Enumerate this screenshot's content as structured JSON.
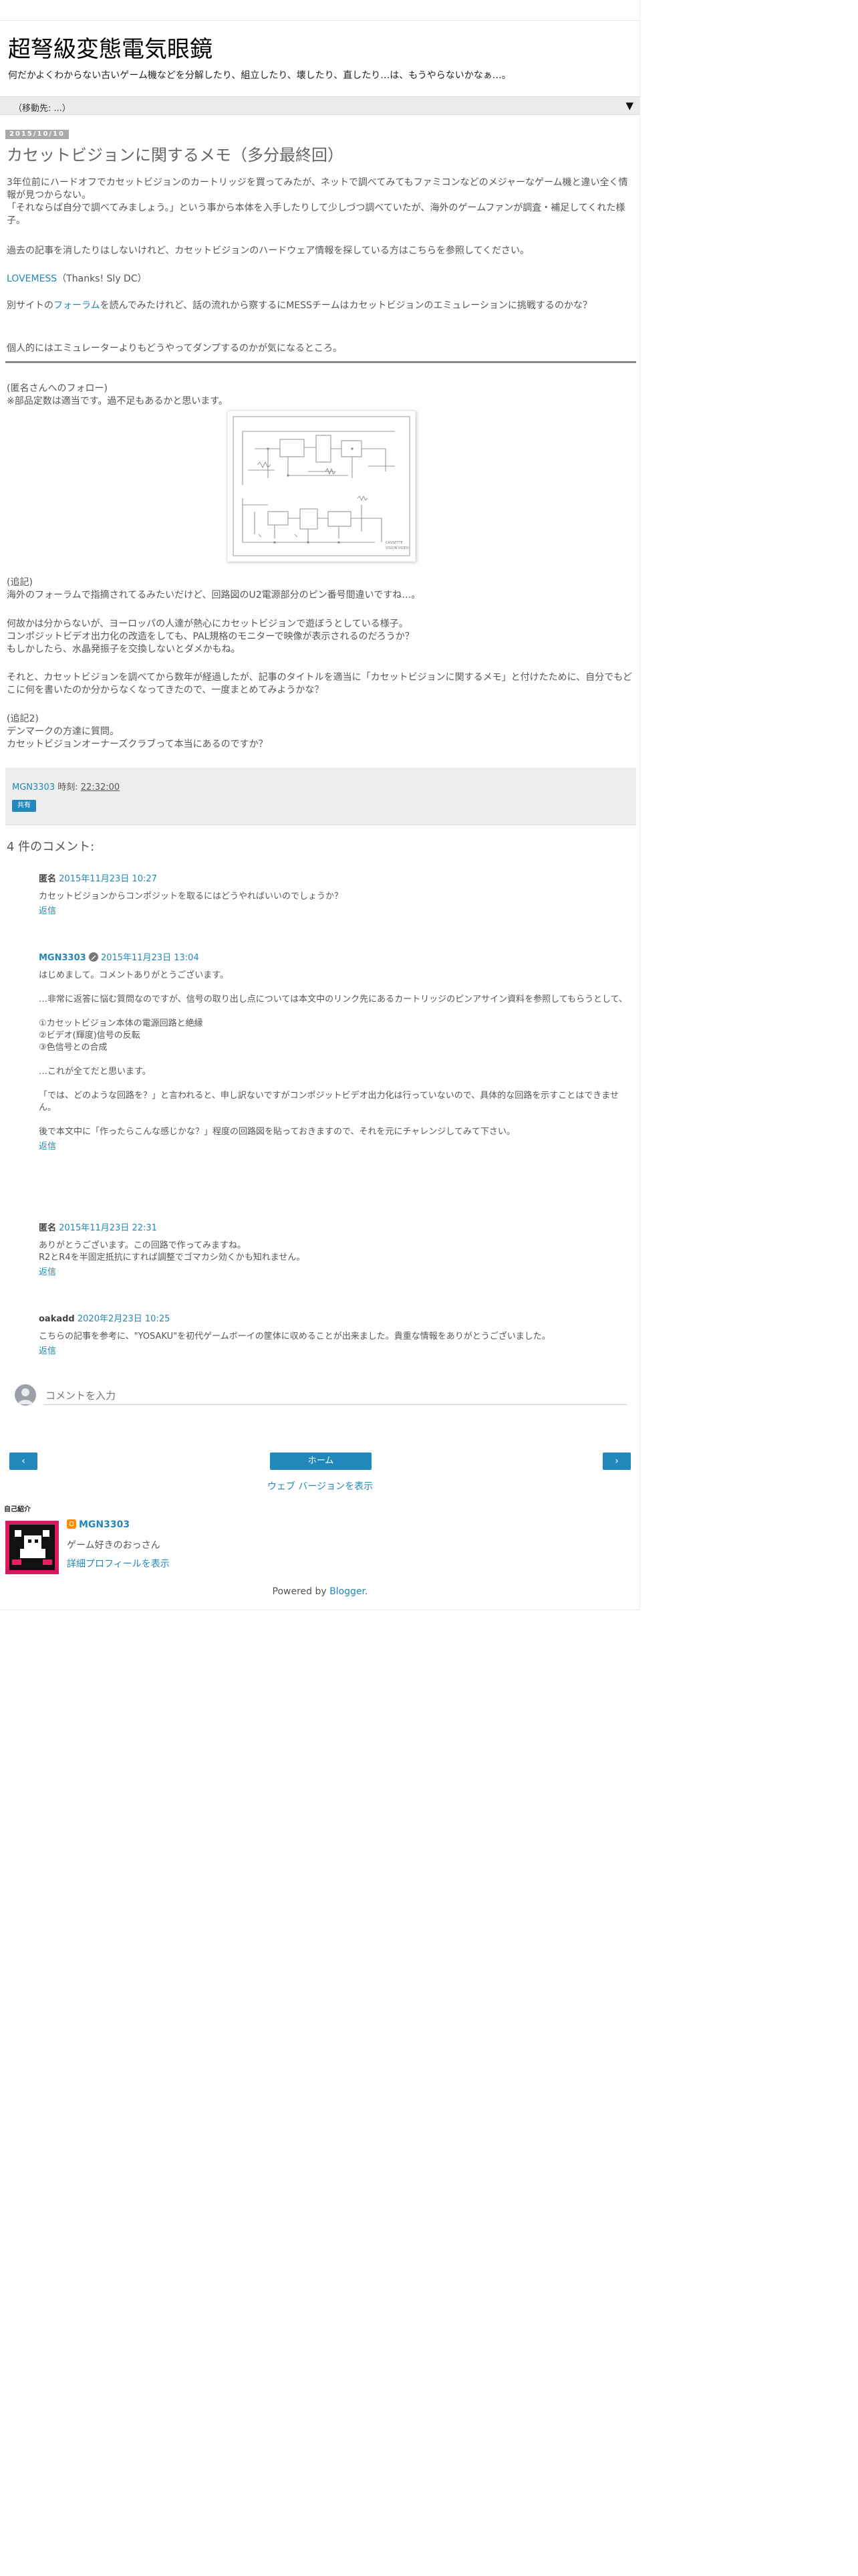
{
  "blog": {
    "title": "超弩級変態電気眼鏡",
    "description": "何だかよくわからない古いゲーム機などを分解したり、組立したり、壊したり、直したり…は、もうやらないかなぁ…。"
  },
  "nav": {
    "select_value": "（移動先: ...）",
    "arrow": "▼"
  },
  "post": {
    "date_header": "2015/10/10",
    "title": "カセットビジョンに関するメモ（多分最終回）",
    "paragraphs": [
      "3年位前にハードオフでカセットビジョンのカートリッジを買ってみたが、ネットで調べてみてもファミコンなどのメジャーなゲーム機と違い全く情報が見つからない。",
      "「それならば自分で調べてみましょう。」という事から本体を入手したりして少しづつ調べていたが、海外のゲームファンが調査・補足してくれた様子。",
      "過去の記事を消したりはしないけれど、カセットビジョンのハードウェア情報を探している方はこちらを参照してください。"
    ],
    "lovemess_link": "LOVEMESS",
    "lovemess_thanks": "（Thanks! Sly DC）",
    "forum_pre": "別サイトの",
    "forum_link": "フォーラム",
    "forum_post": "を読んでみたけれど、話の流れから察するにMESSチームはカセットビジョンのエミュレーションに挑戦するのかな？",
    "personal_note": "個人的にはエミュレーターよりもどうやってダンプするのかが気になるところ。",
    "followup1_title": "(匿名さんへのフォロー)",
    "followup1_text": "※部品定数は適当です。過不足もあるかと思います。",
    "figure_caption_1": "CASSETTE",
    "figure_caption_2": "VISION VIDEO",
    "addendum1_title": "(追記)",
    "addendum1_text": "海外のフォーラムで指摘されてるみたいだけど、回路図のU2電源部分のピン番号間違いですね…。",
    "p_europe_1": "何故かは分からないが、ヨーロッパの人達が熱心にカセットビジョンで遊ぼうとしている様子。",
    "p_europe_2": "コンポジットビデオ出力化の改造をしても、PAL規格のモニターで映像が表示されるのだろうか？",
    "p_europe_3": "もしかしたら、水晶発振子を交換しないとダメかもね。",
    "p_title_note": "それと、カセットビジョンを調べてから数年が経過したが、記事のタイトルを適当に「カセットビジョンに関するメモ」と付けたために、自分でもどこに何を書いたのか分からなくなってきたので、一度まとめてみようかな？",
    "addendum2_title": "(追記2)",
    "addendum2_text1": "デンマークの方達に質問。",
    "addendum2_text2": "カセットビジョンオーナーズクラブって本当にあるのですか？"
  },
  "post_footer": {
    "author": "MGN3303",
    "time_label": "時刻:",
    "time": "22:32:00",
    "share_label": "共有"
  },
  "comments": {
    "header": "4 件のコメント:",
    "reply_label": "返信",
    "items": [
      {
        "author": "匿名",
        "date": "2015年11月23日 10:27",
        "lines": [
          "カセットビジョンからコンポジットを取るにはどうやればいいのでしょうか？"
        ]
      },
      {
        "author": "MGN3303",
        "date": "2015年11月23日 13:04",
        "lines": [
          "はじめまして。コメントありがとうございます。",
          "",
          "…非常に返答に悩む質問なのですが、信号の取り出し点については本文中のリンク先にあるカートリッジのピンアサイン資料を参照してもらうとして、",
          "",
          "①カセットビジョン本体の電源回路と絶縁",
          "②ビデオ(輝度)信号の反転",
          "③色信号との合成",
          "",
          "…これが全てだと思います。",
          "",
          "「では、どのような回路を？」と言われると、申し訳ないですがコンポジットビデオ出力化は行っていないので、具体的な回路を示すことはできません。",
          "",
          "後で本文中に「作ったらこんな感じかな？」程度の回路図を貼っておきますので、それを元にチャレンジしてみて下さい。"
        ]
      },
      {
        "author": "匿名",
        "date": "2015年11月23日 22:31",
        "lines": [
          "ありがとうございます。この回路で作ってみますね。",
          "R2とR4を半固定抵抗にすれば調整でゴマカシ効くかも知れません。"
        ]
      },
      {
        "author": "oakadd",
        "date": "2020年2月23日 10:25",
        "lines": [
          "こちらの記事を参考に、\"YOSAKU\"を初代ゲームボーイの筐体に収めることが出来ました。貴重な情報をありがとうございました。"
        ]
      }
    ],
    "input_placeholder": "コメントを入力"
  },
  "pager": {
    "prev": "‹",
    "home": "ホーム",
    "next": "›",
    "web_version": "ウェブ バージョンを表示"
  },
  "profile": {
    "heading": "自己紹介",
    "name": "MGN3303",
    "description": "ゲーム好きのおっさん",
    "more_link": "詳細プロフィールを表示"
  },
  "footer": {
    "powered_by": "Powered by",
    "blogger": "Blogger",
    "period": "."
  },
  "colors": {
    "link": "#2288bb",
    "footer_bg": "#eeeeee",
    "date_bg": "#aaaaaa",
    "profile_bg": "#d81b60"
  }
}
